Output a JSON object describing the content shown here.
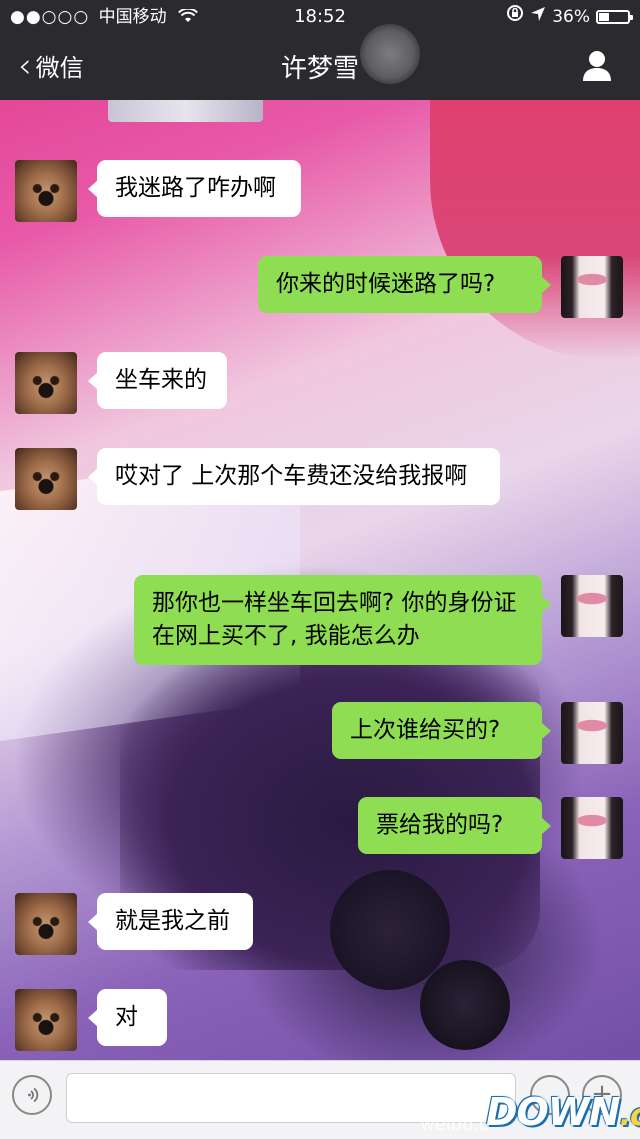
{
  "status_bar": {
    "signal_dots": "●●○○○",
    "carrier": "中国移动",
    "time": "18:52",
    "battery": "36%",
    "battery_level": 0.36
  },
  "nav": {
    "back_label": "微信",
    "title": "许梦雪"
  },
  "messages": [
    {
      "side": "left",
      "text": "我迷路了咋办啊"
    },
    {
      "side": "right",
      "text": "你来的时候迷路了吗?"
    },
    {
      "side": "left",
      "text": "坐车来的"
    },
    {
      "side": "left",
      "text": "哎对了 上次那个车费还没给我报啊"
    },
    {
      "side": "right",
      "text": "那你也一样坐车回去啊? 你的身份证在网上买不了, 我能怎么办"
    },
    {
      "side": "right",
      "text": "上次谁给买的?"
    },
    {
      "side": "right",
      "text": "票给我的吗?"
    },
    {
      "side": "left",
      "text": "就是我之前"
    },
    {
      "side": "left",
      "text": "对"
    }
  ],
  "input_bar": {
    "placeholder": ""
  },
  "watermark": {
    "weibo": "weibo.c",
    "site": "DOWN",
    "site_suffix": ".cc"
  }
}
